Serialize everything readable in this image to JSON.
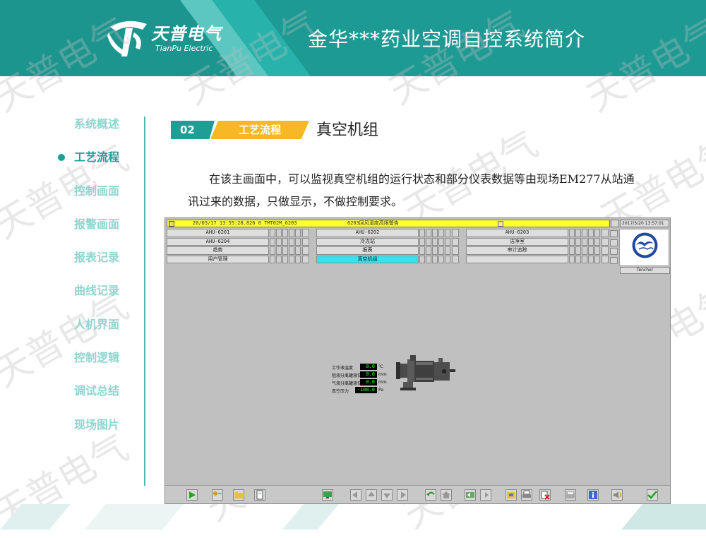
{
  "header": {
    "logo_cn": "天普电气",
    "logo_en": "TianPu Electric",
    "title": "金华***药业空调自控系统简介"
  },
  "nav": {
    "items": [
      "系统概述",
      "工艺流程",
      "控制画面",
      "报警画面",
      "报表记录",
      "曲线记录",
      "人机界面",
      "控制逻辑",
      "调试总结",
      "现场图片"
    ],
    "active_index": 1
  },
  "section": {
    "number": "02",
    "tag": "工艺流程",
    "title": "真空机组"
  },
  "description": "在该主画面中，可以监视真空机组的运行状态和部分仪表数据等由现场EM277从站通讯过来的数据，只做显示，不做控制要求。",
  "scada": {
    "alarm": {
      "time": "20/03/17 13:55:28.826 0  TMT02M_6203",
      "message": "6203回风湿度高限警告"
    },
    "clock": "2017/3/20 13:57:01",
    "emblem_label": "Tencher",
    "nav_rows": [
      [
        "AHU-6201",
        "AHU-6202",
        "AHU-6203"
      ],
      [
        "AHU-6204",
        "冷冻站",
        "洁净室"
      ],
      [
        "趋势",
        "报表",
        "审计追踪"
      ],
      [
        "用户管理",
        "真空机组",
        ""
      ]
    ],
    "active_button": "真空机组",
    "readings": [
      {
        "label": "工作液温度",
        "value": "0.0",
        "unit": "℃"
      },
      {
        "label": "阻液分离罐液位",
        "value": "0.0",
        "unit": "mm"
      },
      {
        "label": "气液分离罐液位",
        "value": "0.0",
        "unit": "mm"
      },
      {
        "label": "真空压力",
        "value": "-100.0",
        "unit": "Pa"
      }
    ],
    "toolbar_icons": [
      "play-icon",
      "key-icon",
      "folder-icon",
      "document-icon",
      "screen-icon",
      "arrow-left-icon",
      "arrow-up-icon",
      "arrow-down-icon",
      "arrow-right-icon",
      "undo-icon",
      "home-icon",
      "back-icon",
      "forward-icon",
      "save-icon",
      "print-icon",
      "delete-icon",
      "disk-icon",
      "info-icon",
      "sound-icon",
      "check-icon"
    ]
  },
  "watermark": "天普电气",
  "colors": {
    "teal": "#1f9e96",
    "teal_light": "#8fd5cf",
    "yellow": "#f6b824",
    "alarm_yellow": "#ffff33",
    "active_cyan": "#35e3f0"
  }
}
